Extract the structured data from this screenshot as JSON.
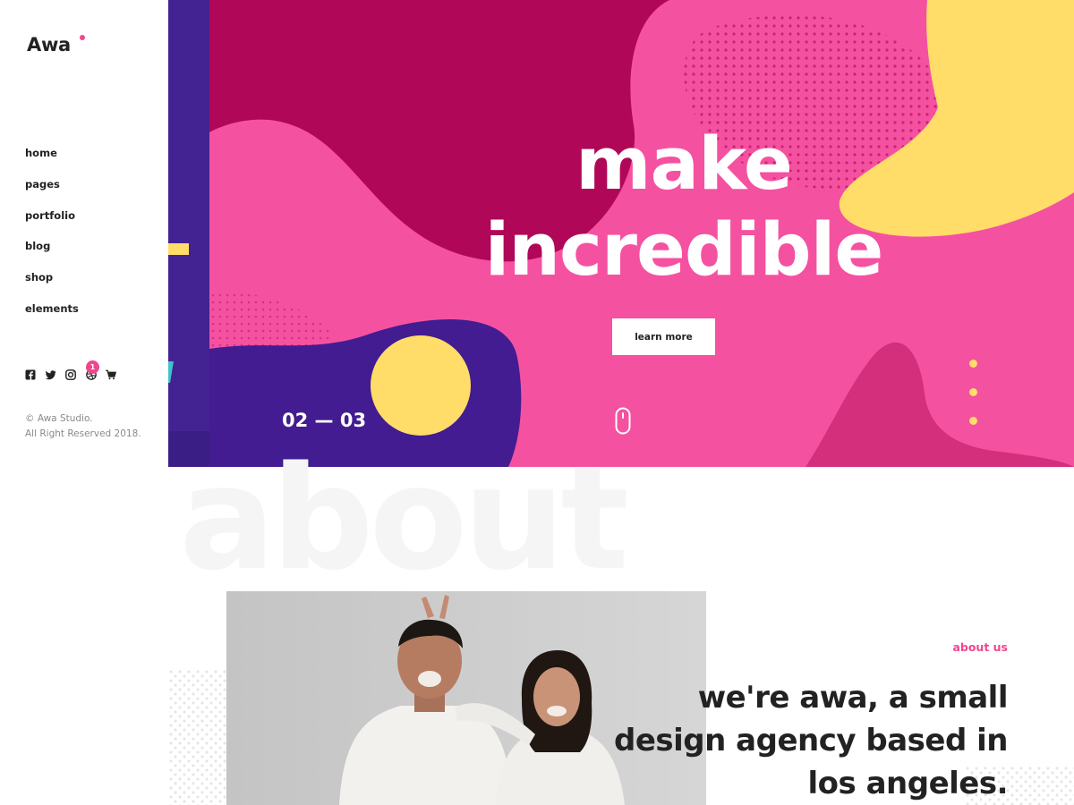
{
  "brand": {
    "name": "Awa",
    "accent": "#f0468e"
  },
  "nav": {
    "items": [
      "home",
      "pages",
      "portfolio",
      "blog",
      "shop",
      "elements"
    ]
  },
  "socials": {
    "icons": [
      "facebook-icon",
      "twitter-icon",
      "instagram-icon",
      "dribbble-icon",
      "cart-icon"
    ],
    "cart_count": "1"
  },
  "footer": {
    "line1": "© Awa Studio.",
    "line2": "All Right Reserved 2018."
  },
  "hero": {
    "title_line1": "make",
    "title_line2": "incredible",
    "button_label": "learn more",
    "counter": "02 — 03",
    "colors": {
      "pink": "#f551a1",
      "magenta": "#b00758",
      "purple": "#421c90",
      "yellow": "#ffdd68",
      "mid_pink": "#d42f7c"
    }
  },
  "about": {
    "watermark": "about",
    "label": "about us",
    "heading_line1": "we're awa, a small",
    "heading_line2": "design agency based in",
    "heading_line3": "los angeles."
  }
}
